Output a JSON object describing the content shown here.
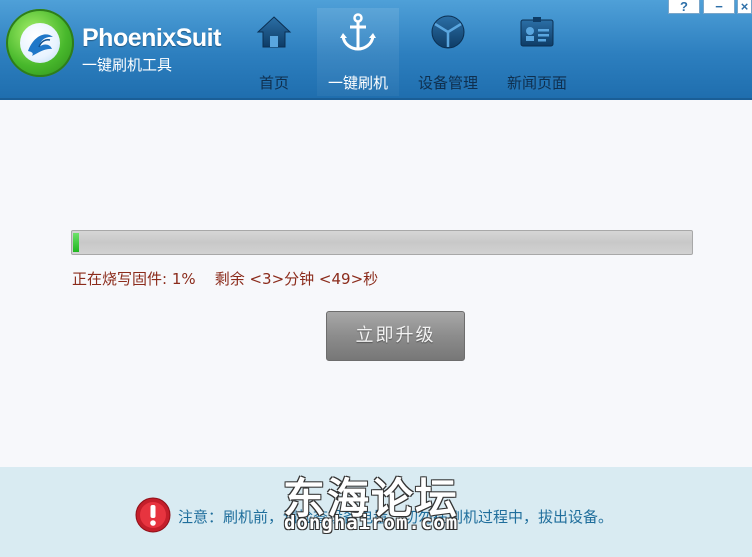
{
  "app": {
    "title": "PhoenixSuit",
    "subtitle": "一键刷机工具",
    "accent_color": "#2d7fbf"
  },
  "window_buttons": [
    {
      "label": "?",
      "icon": "help-icon"
    },
    {
      "label": "−",
      "icon": "minimize-icon"
    },
    {
      "label": "×",
      "icon": "close-icon"
    }
  ],
  "nav": {
    "items": [
      {
        "label": "首页",
        "icon": "home-icon",
        "active": false
      },
      {
        "label": "一键刷机",
        "icon": "anchor-icon",
        "active": true
      },
      {
        "label": "设备管理",
        "icon": "device-cube-icon",
        "active": false
      },
      {
        "label": "新闻页面",
        "icon": "news-card-icon",
        "active": false
      }
    ]
  },
  "flash": {
    "progress_percent": 1,
    "status_text": "正在烧写固件: 1%    剩余 <3>分钟 <49>秒",
    "upgrade_button": "立即升级",
    "progress_color": "#1fb61f"
  },
  "footer": {
    "notice": "注意：刷机前，请检查设备电量，切勿在刷机过程中，拔出设备。",
    "warning_icon": "warning-icon",
    "watermark_title": "东海论坛",
    "watermark_url": "donghairom.com"
  }
}
